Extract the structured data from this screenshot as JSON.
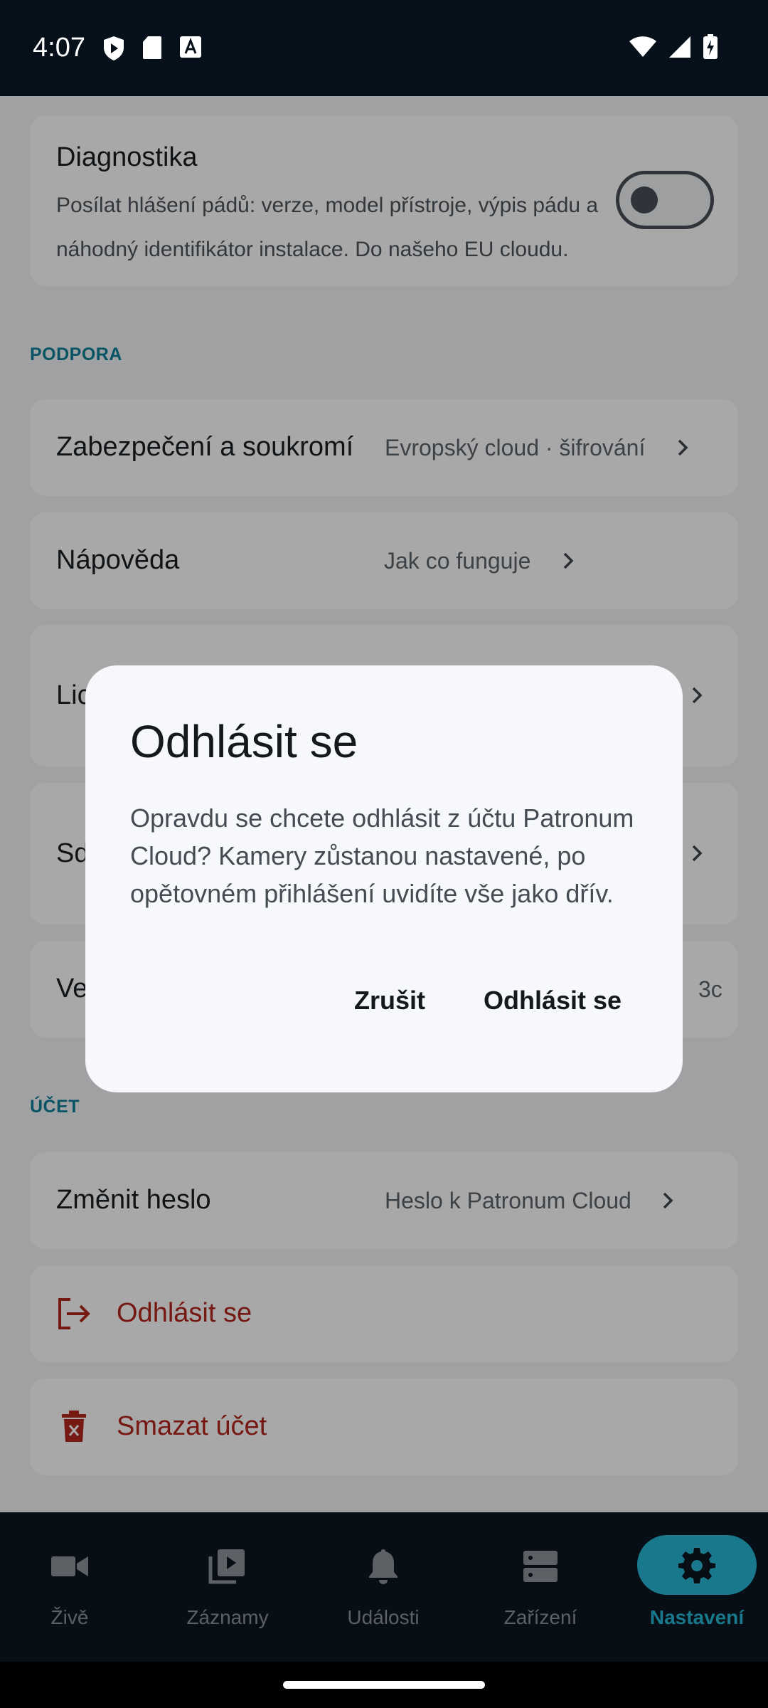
{
  "status_bar": {
    "time": "4:07",
    "left_icons": [
      "shield-icon",
      "sd-card-icon",
      "keyboard-a-icon"
    ],
    "right_icons": [
      "wifi-icon",
      "signal-icon",
      "battery-charging-icon"
    ]
  },
  "settings": {
    "diagnostics": {
      "title": "Diagnostika",
      "description": "Posílat hlášení pádů: verze, model přístroje, výpis pádu a náhodný identifikátor instalace. Do našeho EU cloudu.",
      "enabled": false
    },
    "support_section_label": "PODPORA",
    "support_rows": [
      {
        "title": "Zabezpečení a soukromí",
        "value": "Evropský cloud · šifrování"
      },
      {
        "title": "Nápověda",
        "value": "Jak co funguje"
      },
      {
        "title": "Lic",
        "value": ""
      },
      {
        "title": "Sd",
        "value": ""
      },
      {
        "title": "Ve",
        "value": "3c"
      }
    ],
    "account_section_label": "ÚČET",
    "change_password": {
      "title": "Změnit heslo",
      "value": "Heslo k Patronum Cloud"
    },
    "logout_label": "Odhlásit se",
    "delete_account_label": "Smazat účet",
    "danger_color": "#b3261e"
  },
  "bottom_nav": {
    "items": [
      {
        "label": "Živě",
        "icon": "video-camera-icon"
      },
      {
        "label": "Záznamy",
        "icon": "video-library-icon"
      },
      {
        "label": "Události",
        "icon": "bell-icon"
      },
      {
        "label": "Zařízení",
        "icon": "devices-icon"
      },
      {
        "label": "Nastavení",
        "icon": "gear-icon"
      }
    ],
    "active": "Nastavení",
    "accent_color": "#27b6d4"
  },
  "dialog": {
    "title": "Odhlásit se",
    "body": "Opravdu se chcete odhlásit z účtu Patronum Cloud? Kamery zůstanou nastavené, po opětovném přihlášení uvidíte vše jako dřív.",
    "cancel_label": "Zrušit",
    "confirm_label": "Odhlásit se"
  }
}
